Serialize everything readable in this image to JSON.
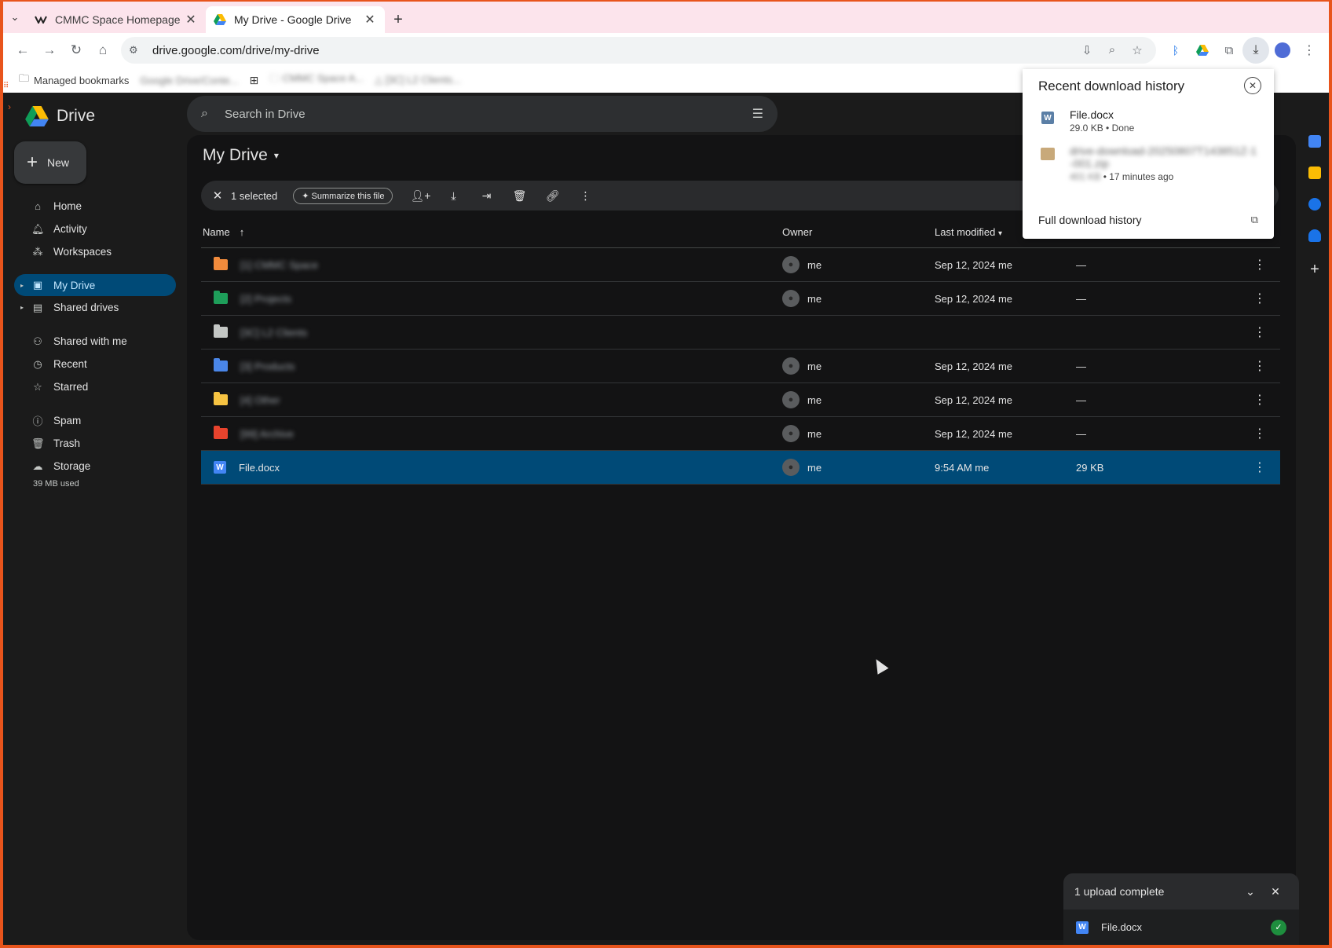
{
  "browser": {
    "tabs": [
      {
        "title": "CMMC Space Homepage",
        "active": false
      },
      {
        "title": "My Drive - Google Drive",
        "active": true
      }
    ],
    "url": "drive.google.com/drive/my-drive",
    "bookmarks_label": "Managed bookmarks"
  },
  "drive": {
    "logo_text": "Drive",
    "search_placeholder": "Search in Drive",
    "new_label": "New",
    "nav": {
      "home": "Home",
      "activity": "Activity",
      "workspaces": "Workspaces",
      "my_drive": "My Drive",
      "shared_drives": "Shared drives",
      "shared_with_me": "Shared with me",
      "recent": "Recent",
      "starred": "Starred",
      "spam": "Spam",
      "trash": "Trash",
      "storage": "Storage",
      "storage_used": "39 MB used"
    },
    "page_title": "My Drive",
    "selection": {
      "count": "1 selected",
      "summarize": "Summarize this file"
    },
    "columns": {
      "name": "Name",
      "owner": "Owner",
      "modified": "Last modified"
    },
    "rows": [
      {
        "name": "[1] CMMC Space",
        "owner": "me",
        "modified": "Sep 12, 2024 me",
        "size": "—",
        "color": "#f28b3c",
        "blurred": true
      },
      {
        "name": "[2] Projects",
        "owner": "me",
        "modified": "Sep 12, 2024 me",
        "size": "—",
        "color": "#1e9e5a",
        "blurred": true
      },
      {
        "name": "[3C] L2 Clients",
        "owner": "",
        "modified": "",
        "size": "",
        "color": "#c4c7c5",
        "blurred": true
      },
      {
        "name": "[3] Products",
        "owner": "me",
        "modified": "Sep 12, 2024 me",
        "size": "—",
        "color": "#4a86e8",
        "blurred": true
      },
      {
        "name": "[4] Other",
        "owner": "me",
        "modified": "Sep 12, 2024 me",
        "size": "—",
        "color": "#f6c342",
        "blurred": true
      },
      {
        "name": "[99] Archive",
        "owner": "me",
        "modified": "Sep 12, 2024 me",
        "size": "—",
        "color": "#e8432d",
        "blurred": true
      },
      {
        "name": "File.docx",
        "owner": "me",
        "modified": "9:54 AM me",
        "size": "29 KB",
        "color": "#4285f4",
        "blurred": false,
        "selected": true
      }
    ]
  },
  "download_popup": {
    "title": "Recent download history",
    "items": [
      {
        "name": "File.docx",
        "meta": "29.0 KB • Done"
      },
      {
        "name": "drive-download-20250807T143851Z-1-001.zip",
        "size": "401 KB",
        "time": "17 minutes ago"
      }
    ],
    "full_history": "Full download history"
  },
  "upload_toast": {
    "title": "1 upload complete",
    "file": "File.docx"
  }
}
